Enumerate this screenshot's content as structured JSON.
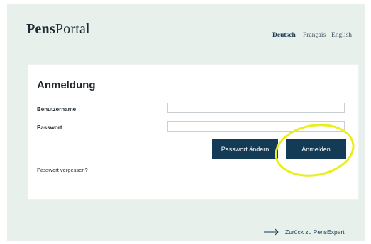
{
  "header": {
    "logo_bold": "Pens",
    "logo_regular": "Portal",
    "languages": [
      {
        "label": "Deutsch",
        "active": true
      },
      {
        "label": "Français",
        "active": false
      },
      {
        "label": "English",
        "active": false
      }
    ]
  },
  "login": {
    "title": "Anmeldung",
    "username_label": "Benutzername",
    "username_value": "",
    "password_label": "Passwort",
    "password_value": "",
    "change_password_button": "Passwort ändern",
    "login_button": "Anmelden",
    "forgot_password_link": "Passwort vergessen?"
  },
  "footer": {
    "back_link": "Zurück zu PensExpert",
    "arrow_icon": "arrow-right-icon"
  },
  "colors": {
    "background": "#e8f0ec",
    "primary": "#143b55",
    "highlight": "#e9ee1c"
  }
}
